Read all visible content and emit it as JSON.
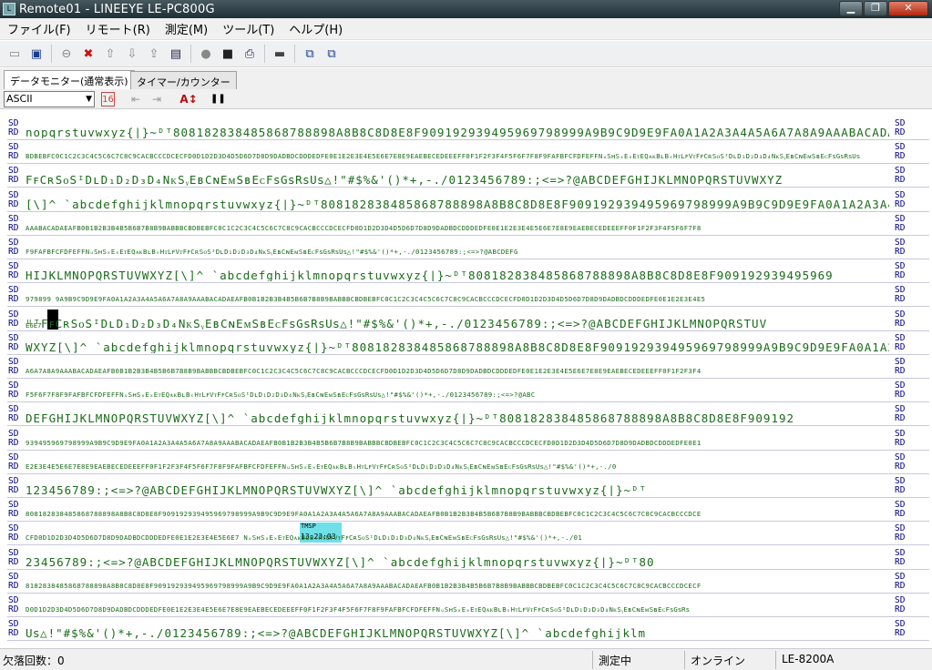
{
  "window": {
    "title": "Remote01 - LINEEYE LE-PC800G",
    "app_icon": "line-eye-icon"
  },
  "menu": [
    "ファイル(F)",
    "リモート(R)",
    "測定(M)",
    "ツール(T)",
    "ヘルプ(H)"
  ],
  "tabs": [
    {
      "label": "データモニター(通常表示)",
      "active": true
    },
    {
      "label": "タイマー/カウンター",
      "active": false
    }
  ],
  "controls": {
    "code_select": "ASCII",
    "hex_toggle": "16",
    "font_size_label": "A↕",
    "pause_label": "❚❚"
  },
  "monitor": {
    "side_labels": {
      "send": "SD",
      "receive": "RD"
    },
    "rows": [
      {
        "text": "nopqrstuvwxyz{|}~ᴰᵀ808182838485868788898A8B8C8D8E8F909192939495969798999A9B9C9D9E9FA0A1A2A3A4A5A6A7A8A9AAABACADAEAFB0B1B2B3B4B5B6B7B8B9BABBBC",
        "size": "big"
      },
      {
        "text": "BDBEBFC0C1C2C3C4C5C6C7C8C9CACBCCCDCECFD0D1D2D3D4D5D6D7D8D9DADBDCDDDEDFE0E1E2E3E4E5E6E7E8E9EAEBECEDEEEFF0F1F2F3F4F5F6F7F8F9FAFBFCFDFEFFNᵤSʜSₓEₓEᴛEQᴀᴋBʟBₛHᴛLꜰVᴛFꜰCʀSᴏSᴵDʟD₁D₂D₃D₄NᴋSᵧEʙCɴEᴍSʙEᴄFꜱGꜱRꜱUꜱ",
        "size": "small"
      },
      {
        "text": "FꜰCʀSᴏSᴵDʟD₁D₂D₃D₄NᴋSᵧEʙCɴEᴍSʙEᴄFꜱGꜱRꜱUꜱ△!\"#$%&'()*+,-./0123456789:;<=>?@ABCDEFGHIJKLMNOPQRSTUVWXYZ",
        "size": "big"
      },
      {
        "text": "[\\]^_`abcdefghijklmnopqrstuvwxyz{|}~ᴰᵀ808182838485868788898A8B8C8D8E8F909192939495969798999A9B9C9D9E9FA0A1A2A3A4A5A6A7A8A9",
        "size": "big"
      },
      {
        "text": "AAABACADAEAFB0B1B2B3B4B5B6B7B8B9BABBBCBDBEBFC0C1C2C3C4C5C6C7C8C9CACBCCCDCECFD0D1D2D3D4D5D6D7D8D9DADBDCDDDEDFE0E1E2E3E4E5E6E7E8E9EAEBECEDEEEFF0F1F2F3F4F5F6F7F8",
        "size": "small"
      },
      {
        "text": "F9FAFBFCFDFEFFNᵤSʜSₓEₓEᴛEQᴀᴋBʟBₛHᴛLꜰVᴛFꜰCʀSᴏSᴵDʟD₁D₂D₃D₄NᴋSᵧEʙCɴEᴍSʙEᴄFꜱGꜱRꜱUꜱ△!\"#$%&'()*+,-./0123456789:;<=>?@ABCDEFG",
        "size": "small"
      },
      {
        "text": "HIJKLMNOPQRSTUVWXYZ[\\]^_`abcdefghijklmnopqrstuvwxyz{|}~ᴰᵀ808182838485868788898A8B8C8D8E8F909192939495969",
        "size": "big"
      },
      {
        "text": "979899 9A9B9C9D9E9FA0A1A2A3A4A5A6A7A8A9AAABACADAEAFB0B1B2B3B4B5B6B7B8B9BABBBCBDBEBFC0C1C2C3C4C5C6C7C8C9CACBCCCDCECFD0D1D2D3D4D5D6D7D8D9DADBDCDDDEDFE0E1E2E3E4E5",
        "size": "small"
      },
      {
        "text": "   ᵁᵀFꜰCʀSᴏSᴵDʟD₁D₂D₃D₄NᴋSᵧEʙCɴEᴍSʙEᴄFꜱGꜱRꜱUꜱ△!\"#$%&'()*+,-./0123456789:;<=>?@ABCDEFGHIJKLMNOPQRSTUV",
        "size": "big",
        "prefix": "E6E7"
      },
      {
        "text": "WXYZ[\\]^_`abcdefghijklmnopqrstuvwxyz{|}~ᴰᵀ808182838485868788898A8B8C8D8E8F909192939495969798999A9B9C9D9E9FA0A1A2A3A4A5",
        "size": "big"
      },
      {
        "text": "A6A7A8A9AAABACADAEAFB0B1B2B3B4B5B6B7B8B9BABBBCBDBEBFC0C1C2C3C4C5C6C7C8C9CACBCCCDCECFD0D1D2D3D4D5D6D7D8D9DADBDCDDDEDFE0E1E2E3E4E5E6E7E8E9EAEBECEDEEEFF0F1F2F3F4",
        "size": "small"
      },
      {
        "text": "F5F6F7F8F9FAFBFCFDFEFFNᵤSʜSₓEₓEᴛEQᴀᴋBʟBₛHᴛLꜰVᴛFꜰCʀSᴏSᴵDʟD₁D₂D₃D₄NᴋSᵧEʙCɴEᴍSʙEᴄFꜱGꜱRꜱUꜱ△!\"#$%&'()*+,-./0123456789:;<=>?@ABC",
        "size": "small"
      },
      {
        "text": "DEFGHIJKLMNOPQRSTUVWXYZ[\\]^_`abcdefghijklmnopqrstuvwxyz{|}~ᴰᵀ808182838485868788898A8B8C8D8E8F909192",
        "size": "big"
      },
      {
        "text": "939495969798999A9B9C9D9E9FA0A1A2A3A4A5A6A7A8A9AAABACADAEAFB0B1B2B3B4B5B6B7B8B9BABBBCBDBEBFC0C1C2C3C4C5C6C7C8C9CACBCCCDCECFD0D1D2D3D4D5D6D7D8D9DADBDCDDDEDFE0E1",
        "size": "small"
      },
      {
        "text": "E2E3E4E5E6E7E8E9EAEBECEDEEEFF0F1F2F3F4F5F6F7F8F9FAFBFCFDFEFFNᵤSʜSₓEₓEᴛEQᴀᴋBʟBₛHᴛLꜰVᴛFꜰCʀSᴏSᴵDʟD₁D₂D₃D₄NᴋSᵧEʙCɴEᴍSʙEᴄFꜱGꜱRꜱUꜱ△!\"#$%&'()*+,-./0",
        "size": "small"
      },
      {
        "text": "123456789:;<=>?@ABCDEFGHIJKLMNOPQRSTUVWXYZ[\\]^_`abcdefghijklmnopqrstuvwxyz{|}~ᴰᵀ",
        "size": "big"
      },
      {
        "text": "808182838485868788898A8B8C8D8E8F909192939495969798999A9B9C9D9E9FA0A1A2A3A4A5A6A7A8A9AAABACADAEAFB0B1B2B3B4B5B6B7B8B9BABBBCBDBEBFC0C1C2C3C4C5C6C7C8C9CACBCCCDCE",
        "size": "small"
      },
      {
        "text": "CFD0D1D2D3D4D5D6D7D8D9DADBDCDDDEDFE0E1E2E3E4E5E6E7                  NᵤSʜSₓEₓEᴛEQᴀᴋBʟBₛHᴛLꜰVᴛFꜰCʀSᴏSᴵDʟD₁D₂D₃D₄NᴋSᵧEʙCɴEᴍSʙEᴄFꜱGꜱRꜱUꜱ△!\"#$%&'()*+,-./01",
        "size": "small"
      },
      {
        "text": "23456789:;<=>?@ABCDEFGHIJKLMNOPQRSTUVWXYZ[\\]^_`abcdefghijklmnopqrstuvwxyz{|}~ᴰᵀ80",
        "size": "big"
      },
      {
        "text": "8182838485868788898A8B8C8D8E8F909192939495969798999A9B9C9D9E9FA0A1A2A3A4A5A6A7A8A9AAABACADAEAFB0B1B2B3B4B5B6B7B8B9BABBBCBDBEBFC0C1C2C3C4C5C6C7C8C9CACBCCCDCECF",
        "size": "small"
      },
      {
        "text": "D0D1D2D3D4D5D6D7D8D9DADBDCDDDEDFE0E1E2E3E4E5E6E7E8E9EAEBECEDEEEFF0F1F2F3F4F5F6F7F8F9FAFBFCFDFEFFNᵤSʜSₓEₓEᴛEQᴀᴋBʟBₛHᴛLꜰVᴛFꜰCʀSᴏSᴵDʟD₁D₂D₃D₄NᴋSᵧEʙCɴEᴍSʙEᴄFꜱGꜱRꜱ",
        "size": "small"
      },
      {
        "text": "Uꜱ△!\"#$%&'()*+,-./0123456789:;<=>?@ABCDEFGHIJKLMNOPQRSTUVWXYZ[\\]^_`abcdefghijklm",
        "size": "big"
      }
    ],
    "timestamp_marker": {
      "label": "TMSP",
      "time": "13:23:03"
    }
  },
  "status": {
    "dropout": "欠落回数：0",
    "state": "測定中",
    "connection": "オンライン",
    "model": "LE-8200A"
  },
  "colors": {
    "data_text": "#1a6b1a",
    "side_label": "#000080",
    "timestamp_bg": "#6fe0e8"
  }
}
